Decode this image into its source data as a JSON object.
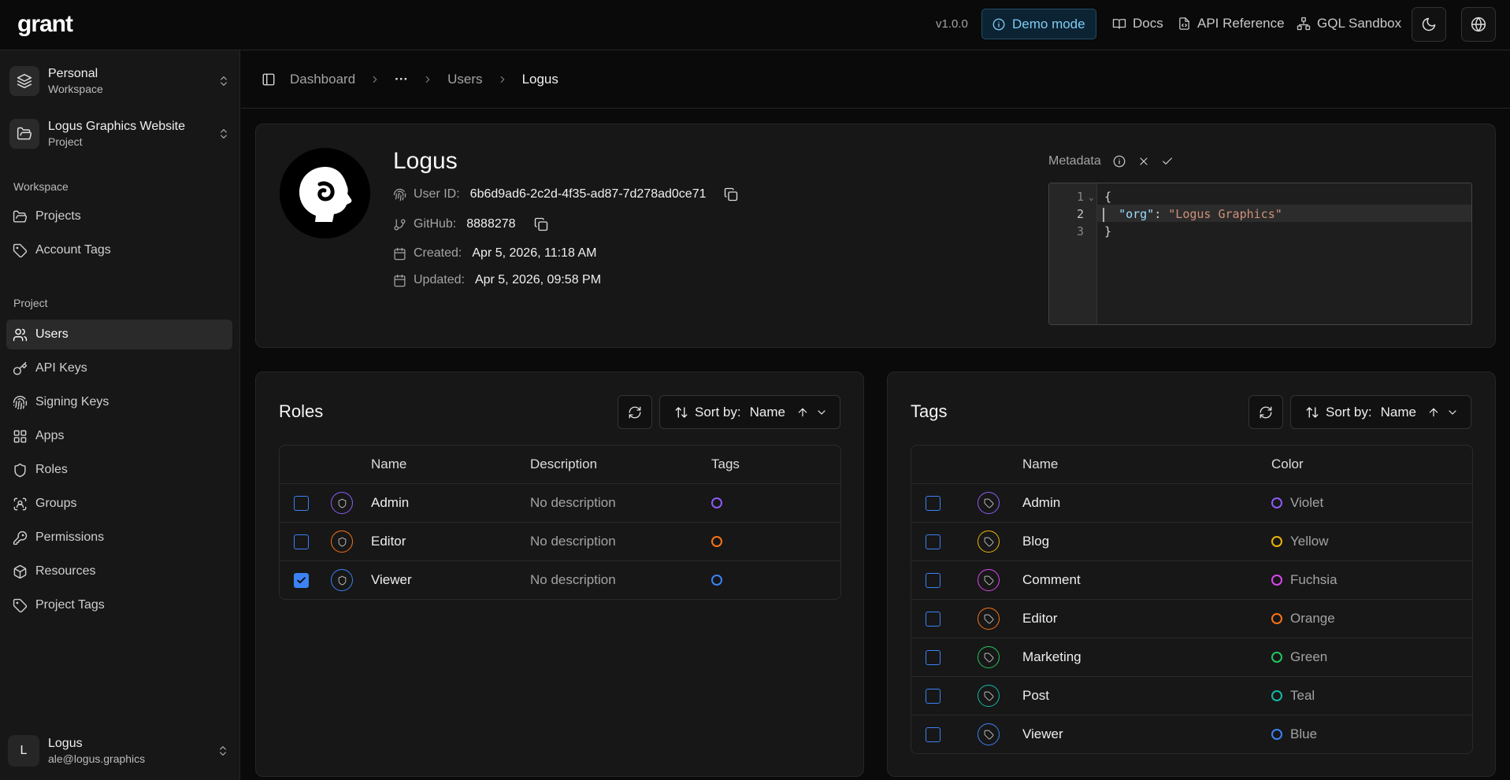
{
  "topbar": {
    "logo": "grant",
    "version": "v1.0.0",
    "demo_label": "Demo mode",
    "links": {
      "docs": "Docs",
      "api": "API Reference",
      "gql": "GQL Sandbox"
    }
  },
  "sidebar": {
    "workspace": {
      "title": "Personal",
      "subtitle": "Workspace"
    },
    "project": {
      "title": "Logus Graphics Website",
      "subtitle": "Project"
    },
    "workspace_section": "Workspace",
    "workspace_items": [
      "Projects",
      "Account Tags"
    ],
    "project_section": "Project",
    "project_items": [
      "Users",
      "API Keys",
      "Signing Keys",
      "Apps",
      "Roles",
      "Groups",
      "Permissions",
      "Resources",
      "Project Tags"
    ],
    "user": {
      "initial": "L",
      "name": "Logus",
      "email": "ale@logus.graphics"
    }
  },
  "breadcrumb": {
    "root": "Dashboard",
    "ellipsis": "···",
    "parent": "Users",
    "current": "Logus"
  },
  "profile": {
    "name": "Logus",
    "user_id_label": "User ID:",
    "user_id": "6b6d9ad6-2c2d-4f35-ad87-7d278ad0ce71",
    "github_label": "GitHub:",
    "github": "8888278",
    "created_label": "Created:",
    "created": "Apr 5, 2026, 11:18 AM",
    "updated_label": "Updated:",
    "updated": "Apr 5, 2026, 09:58 PM"
  },
  "metadata": {
    "label": "Metadata",
    "lines": [
      "{",
      "  \"org\": \"Logus Graphics\"",
      "}"
    ],
    "line_numbers": [
      "1",
      "2",
      "3"
    ]
  },
  "roles": {
    "title": "Roles",
    "sort_label": "Sort by:",
    "sort_value": "Name",
    "columns": {
      "name": "Name",
      "description": "Description",
      "tags": "Tags"
    },
    "rows": [
      {
        "name": "Admin",
        "description": "No description",
        "color": "#8b5cf6",
        "checked": false
      },
      {
        "name": "Editor",
        "description": "No description",
        "color": "#f97316",
        "checked": false
      },
      {
        "name": "Viewer",
        "description": "No description",
        "color": "#3b82f6",
        "checked": true
      }
    ]
  },
  "tags": {
    "title": "Tags",
    "sort_label": "Sort by:",
    "sort_value": "Name",
    "columns": {
      "name": "Name",
      "color": "Color"
    },
    "rows": [
      {
        "name": "Admin",
        "color_name": "Violet",
        "color": "#8b5cf6"
      },
      {
        "name": "Blog",
        "color_name": "Yellow",
        "color": "#eab308"
      },
      {
        "name": "Comment",
        "color_name": "Fuchsia",
        "color": "#d946ef"
      },
      {
        "name": "Editor",
        "color_name": "Orange",
        "color": "#f97316"
      },
      {
        "name": "Marketing",
        "color_name": "Green",
        "color": "#22c55e"
      },
      {
        "name": "Post",
        "color_name": "Teal",
        "color": "#14b8a6"
      },
      {
        "name": "Viewer",
        "color_name": "Blue",
        "color": "#3b82f6"
      }
    ]
  }
}
